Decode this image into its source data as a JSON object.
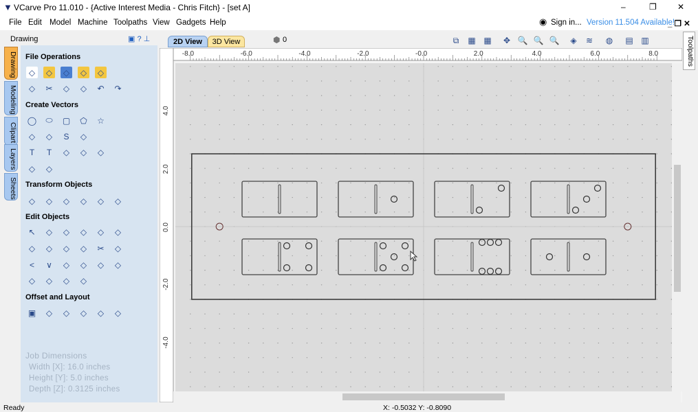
{
  "window": {
    "title": "VCarve Pro 11.010 - {Active Interest Media - Chris Fitch} - [set A]",
    "minimize": "–",
    "restore": "❐",
    "close": "✕"
  },
  "menu": [
    "File",
    "Edit",
    "Model",
    "Machine",
    "Toolpaths",
    "View",
    "Gadgets",
    "Help"
  ],
  "account": {
    "sign_in": "Sign in...",
    "version_notice": "Version 11.504 Available!"
  },
  "panel": {
    "title": "Drawing",
    "side_tabs": [
      "Drawing",
      "Modeling",
      "Clipart",
      "Layers",
      "Sheets"
    ],
    "sections": [
      {
        "label": "File Operations",
        "rows": [
          [
            "new-file",
            "open-file",
            "save-file",
            "open-folder",
            "import"
          ],
          [
            "select-all",
            "cut",
            "copy",
            "paste",
            "undo",
            "redo"
          ]
        ]
      },
      {
        "label": "Create Vectors",
        "rows": [
          [
            "circle",
            "ellipse",
            "rectangle",
            "polygon",
            "star"
          ],
          [
            "polyline",
            "arc",
            "curve",
            "texture"
          ],
          [
            "text",
            "text-box",
            "text-on-curve",
            "auto-layout-text",
            "bend-text"
          ],
          [
            "dimension-cursor",
            "dimension"
          ]
        ]
      },
      {
        "label": "Transform Objects",
        "rows": [
          [
            "move",
            "scale",
            "align-center",
            "mirror",
            "distort",
            "set-origin"
          ]
        ]
      },
      {
        "label": "Edit Objects",
        "rows": [
          [
            "select",
            "node-edit",
            "transform-select",
            "group",
            "ungroup",
            "weld-tool"
          ],
          [
            "weld",
            "subtract",
            "intersect",
            "trim-fill",
            "scissors",
            "fillet"
          ],
          [
            "extend",
            "join",
            "smooth",
            "close-vector",
            "edit-bitmap",
            "trace-bitmap"
          ],
          [
            "fit-curves",
            "curve-split",
            "curve-merge",
            "curve-close"
          ]
        ]
      },
      {
        "label": "Offset and Layout",
        "rows": [
          [
            "offset",
            "array-copy",
            "circular-array",
            "copy-along-vectors",
            "nesting",
            "fit-to-sheet"
          ]
        ]
      }
    ],
    "job_dimensions": {
      "title": "Job Dimensions",
      "width": "Width  [X]: 16.0 inches",
      "height": "Height [Y]: 5.0 inches",
      "depth": "Depth  [Z]: 0.3125 inches"
    }
  },
  "view": {
    "tabs": [
      "2D View",
      "3D View"
    ],
    "layer_count": "0",
    "toolbar": [
      "zoom-extents",
      "snap-grid",
      "grid",
      "pan",
      "zoom-in",
      "zoom-all",
      "zoom-box",
      "toggle-vectors",
      "toggle-toolpaths",
      "render",
      "tile-h",
      "tile-v"
    ],
    "ruler_x": [
      "-8.0",
      "-6.0",
      "-4.0",
      "-2.0",
      "-0.0",
      "2.0",
      "4.0",
      "6.0",
      "8.0"
    ],
    "ruler_y": [
      "4.0",
      "2.0",
      "0.0",
      "-2.0",
      "-4.0"
    ],
    "dominoes": [
      [
        0,
        0
      ],
      [
        0,
        1
      ],
      [
        0,
        2
      ],
      [
        0,
        3
      ],
      [
        0,
        4
      ],
      [
        0,
        5
      ],
      [
        0,
        6
      ],
      [
        1,
        1
      ]
    ],
    "right_tab": "Toolpaths"
  },
  "status": {
    "text": "Ready",
    "coords": "X: -0.5032 Y: -0.8090"
  },
  "colors": {
    "palette_bg": "#d7e4f1",
    "tab_2d": "#b8d2f2",
    "tab_3d": "#fbe6a0",
    "version_link": "#3a8ee6",
    "canvas": "#dcdcdc"
  }
}
